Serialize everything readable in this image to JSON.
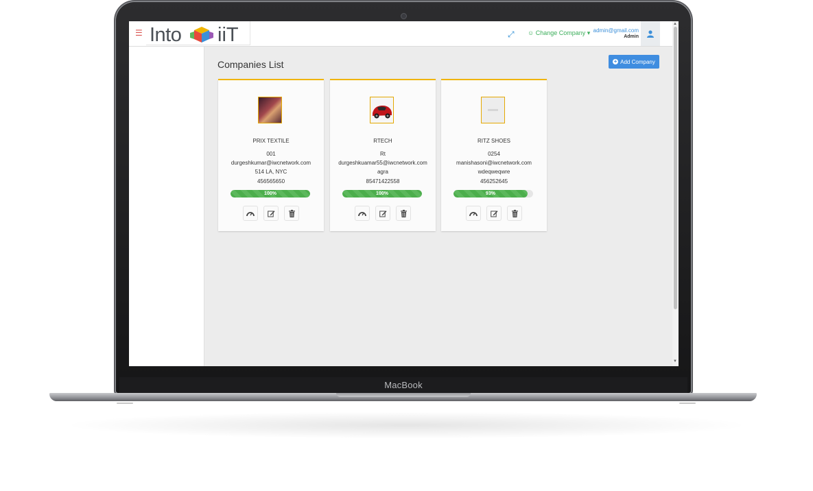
{
  "device": {
    "brand_label": "MacBook"
  },
  "header": {
    "logo_text_left": "Into",
    "logo_text_right": "iiT",
    "change_company_label": "☺ Change Company ▾",
    "user_email": "admin@gmail.com",
    "user_role": "Admin"
  },
  "main": {
    "title": "Companies List",
    "add_button_label": "Add Company"
  },
  "companies": [
    {
      "name": "PRIX TEXTILE",
      "code": "001",
      "email": "durgeshkumar@iwcnetwork.com",
      "address": "514 LA, NYC",
      "phone": "456565650",
      "progress_percent": 100,
      "progress_label": "100%"
    },
    {
      "name": "RTECH",
      "code": "Rt",
      "email": "durgeshkuamar55@iwcnetwork.com",
      "address": "agra",
      "phone": "85471422558",
      "progress_percent": 100,
      "progress_label": "100%"
    },
    {
      "name": "RITZ SHOES",
      "code": "0254",
      "email": "manishasoni@iwcnetwork.com",
      "address": "wdeqweqwre",
      "phone": "456252645",
      "progress_percent": 93,
      "progress_label": "93%"
    }
  ],
  "icons": {
    "menu": "hamburger-icon",
    "fullscreen": "expand-icon",
    "user": "user-icon",
    "dashboard": "dashboard-icon",
    "edit": "edit-icon",
    "delete": "trash-icon"
  },
  "colors": {
    "accent_blue": "#3f8de0",
    "success_green": "#5cb85c",
    "card_top_border": "#f0b400",
    "menu_red": "#d9534f"
  }
}
